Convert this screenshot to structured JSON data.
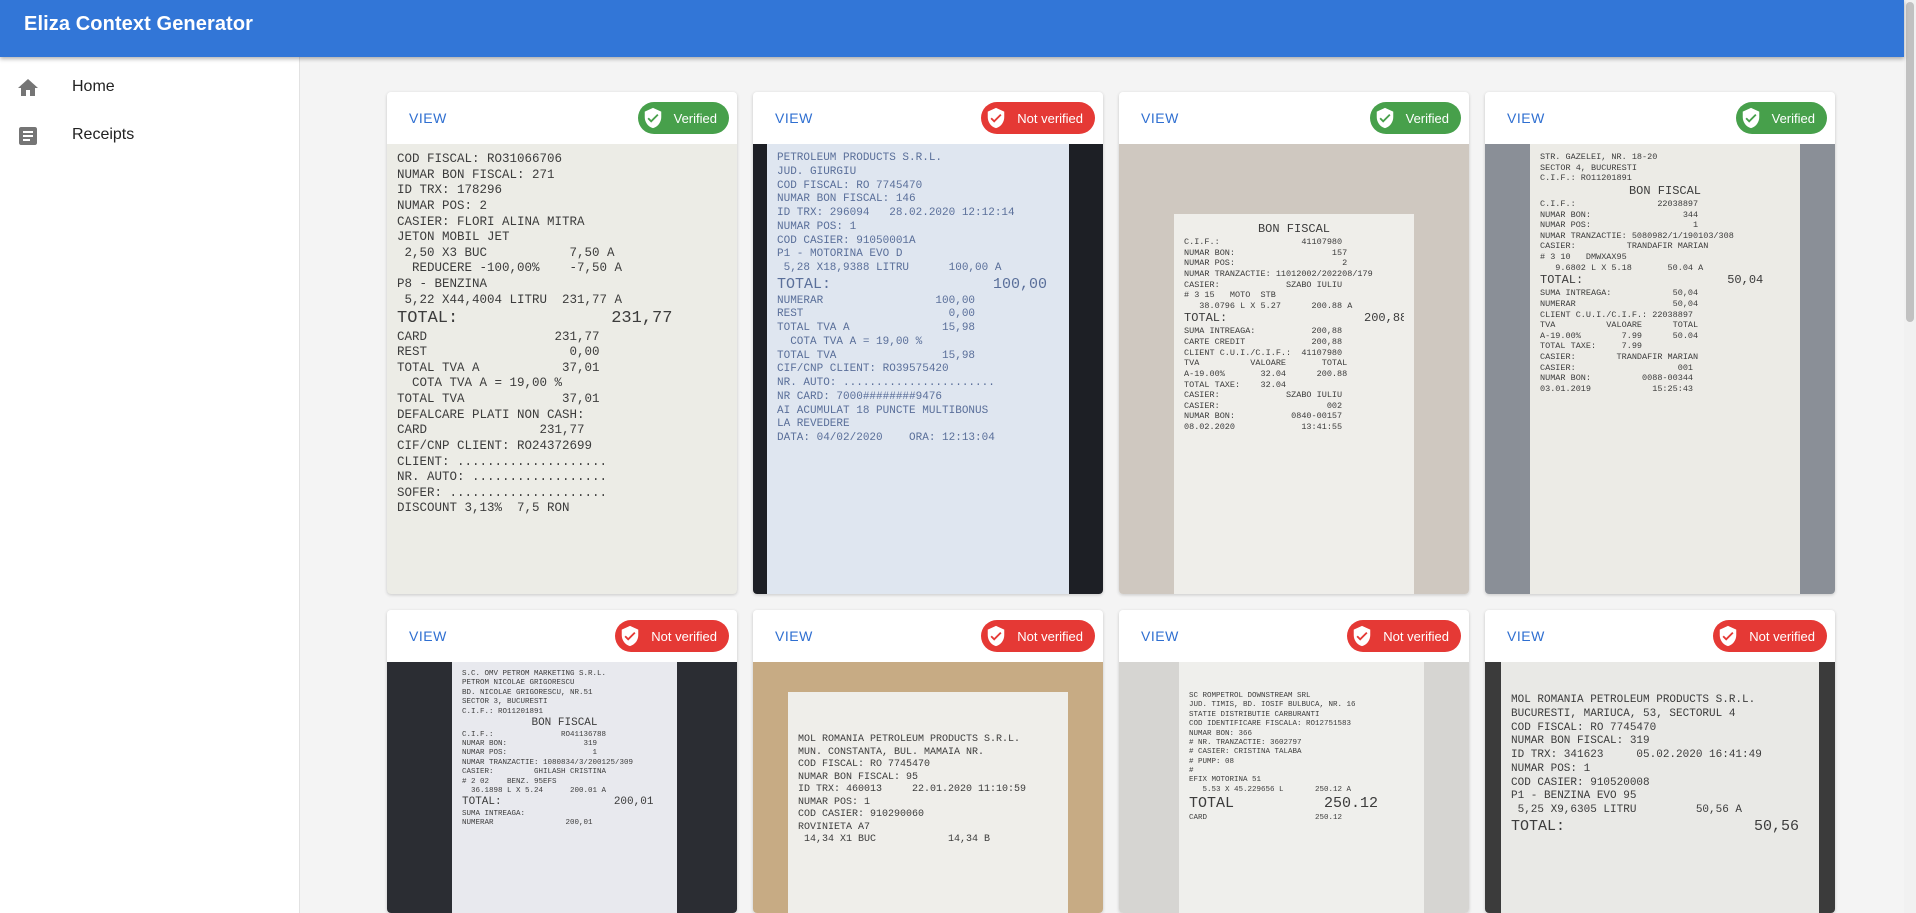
{
  "app": {
    "title": "Eliza Context Generator"
  },
  "nav": [
    {
      "label": "Home",
      "icon": "home-icon"
    },
    {
      "label": "Receipts",
      "icon": "receipt-list-icon"
    }
  ],
  "colors": {
    "appbar": "#3276d7",
    "verified": "#47a04b",
    "not_verified": "#e53935",
    "link": "#2f6fd1"
  },
  "cards": [
    {
      "view_label": "VIEW",
      "status": "Verified",
      "verified": true,
      "receipt_lines": [
        "COD FISCAL: RO31066706",
        "NUMAR BON FISCAL: 271",
        "ID TRX: 178296",
        "NUMAR POS: 2",
        "CASIER: FLORI ALINA MITRA",
        "JETON MOBIL JET",
        " 2,50 X3 BUC           7,50 A",
        "  REDUCERE -100,00%    -7,50 A",
        "P8 - BENZINA",
        " 5,22 X44,4004 LITRU  231,77 A",
        "TOTAL:               231,77",
        "CARD                 231,77",
        "REST                   0,00",
        "TOTAL TVA A           37,01",
        "  COTA TVA A = 19,00 %",
        "TOTAL TVA             37,01",
        "DEFALCARE PLATI NON CASH:",
        "CARD               231,77",
        "CIF/CNP CLIENT: RO24372699",
        "CLIENT: ....................",
        "NR. AUTO: ..................",
        "SOFER: .....................",
        "DISCOUNT 3,13%  7,5 RON"
      ]
    },
    {
      "view_label": "VIEW",
      "status": "Not verified",
      "verified": false,
      "receipt_lines": [
        "PETROLEUM PRODUCTS S.R.L.",
        "JUD. GIURGIU",
        "COD FISCAL: RO 7745470",
        "NUMAR BON FISCAL: 146",
        "ID TRX: 296094   28.02.2020 12:12:14",
        "NUMAR POS: 1",
        "COD CASIER: 91050001A",
        "P1 - MOTORINA EVO D",
        " 5,28 X18,9388 LITRU      100,00 A",
        "TOTAL:                  100,00",
        "NUMERAR                 100,00",
        "REST                      0,00",
        "TOTAL TVA A              15,98",
        "  COTA TVA A = 19,00 %",
        "TOTAL TVA                15,98",
        "CIF/CNP CLIENT: RO39575420",
        "NR. AUTO: .......................",
        "NR CARD: 7000########9476",
        "AI ACUMULAT 18 PUNCTE MULTIBONUS",
        "LA REVEDERE",
        "DATA: 04/02/2020    ORA: 12:13:04"
      ]
    },
    {
      "view_label": "VIEW",
      "status": "Verified",
      "verified": true,
      "receipt_lines": [
        "BON FISCAL",
        "C.I.F.:                41107980",
        "NUMAR BON:                   157",
        "NUMAR POS:                     2",
        "NUMAR TRANZACTIE: 11012002/202208/179",
        "CASIER:             SZABO IULIU",
        "",
        "# 3 15   MOTO  STB",
        "   38.0796 L X 5.27      200.88 A",
        "TOTAL:                   200,88",
        "SUMA INTREAGA:           200,88",
        "CARTE CREDIT             200,88",
        "CLIENT C.U.I./C.I.F.:  41107980",
        "TVA          VALOARE       TOTAL",
        "A-19.00%       32.04      200.88",
        "TOTAL TAXE:    32.04",
        "CASIER:             SZABO IULIU",
        "CASIER:                     002",
        "NUMAR BON:           0840-00157",
        "08.02.2020             13:41:55"
      ]
    },
    {
      "view_label": "VIEW",
      "status": "Verified",
      "verified": true,
      "receipt_lines": [
        "STR. GAZELEI, NR. 18-20",
        "SECTOR 4, BUCURESTI",
        "C.I.F.: RO11201891",
        "BON FISCAL",
        "C.I.F.:                22038897",
        "NUMAR BON:                  344",
        "NUMAR POS:                    1",
        "NUMAR TRANZACTIE: 5080982/1/190103/308",
        "CASIER:          TRANDAFIR MARIAN",
        "",
        "# 3 10   DMWXAX95",
        "   9.6802 L X 5.18       50.04 A",
        "TOTAL:                    50,04",
        "SUMA INTREAGA:            50,04",
        "NUMERAR                   50,04",
        "CLIENT C.U.I./C.I.F.: 22038897",
        "TVA          VALOARE      TOTAL",
        "A-19.00%        7.99      50.04",
        "TOTAL TAXE:     7.99",
        "CASIER:        TRANDAFIR MARIAN",
        "CASIER:                    001",
        "NUMAR BON:          0088-00344",
        "03.01.2019            15:25:43"
      ]
    },
    {
      "view_label": "VIEW",
      "status": "Not verified",
      "verified": false,
      "receipt_lines": [
        "S.C. OMV PETROM MARKETING S.R.L.",
        "PETROM NICOLAE GRIGORESCU",
        "BD. NICOLAE GRIGORESCU, NR.51",
        "SECTOR 3, BUCURESTI",
        "C.I.F.: RO11201891",
        "BON FISCAL",
        "C.I.F.:               RO41136788",
        "NUMAR BON:                 319",
        "NUMAR POS:                   1",
        "NUMAR TRANZACTIE: 1080834/3/200125/309",
        "CASIER:         GHILASH CRISTINA",
        "# 2 02    BENZ. 95EFS",
        "  36.1898 L X 5.24      200.01 A",
        "TOTAL:                 200,01",
        "SUMA INTREAGA:",
        "NUMERAR                200,01"
      ]
    },
    {
      "view_label": "VIEW",
      "status": "Not verified",
      "verified": false,
      "receipt_lines": [
        "MOL ROMANIA PETROLEUM PRODUCTS S.R.L.",
        "MUN. CONSTANTA, BUL. MAMAIA NR.",
        "COD FISCAL: RO 7745470",
        "",
        "NUMAR BON FISCAL: 95",
        "ID TRX: 460013     22.01.2020 11:10:59",
        "NUMAR POS: 1",
        "COD CASIER: 910290060",
        "ROVINIETA A7",
        " 14,34 X1 BUC            14,34 B"
      ]
    },
    {
      "view_label": "VIEW",
      "status": "Not verified",
      "verified": false,
      "receipt_lines": [
        "SC ROMPETROL DOWNSTREAM SRL",
        "JUD. TIMIS, BD. IOSIF BULBUCA, NR. 16",
        "STATIE DISTRIBUTIE CARBURANTI",
        "COD IDENTIFICARE FISCALA: RO12751583",
        "",
        "NUMAR BON: 366",
        "",
        "# NR. TRANZACTIE: 3602797",
        "# CASIER: CRISTINA TALABA",
        "# PUMP: 08",
        "#",
        "EFIX MOTORINA 51",
        "   5.53 X 45.229656 L       250.12 A",
        "",
        "TOTAL          250.12",
        "CARD                        250.12"
      ]
    },
    {
      "view_label": "VIEW",
      "status": "Not verified",
      "verified": false,
      "receipt_lines": [
        "MOL ROMANIA PETROLEUM PRODUCTS S.R.L.",
        "BUCURESTI, MARIUCA, 53, SECTORUL 4",
        "COD FISCAL: RO 7745470",
        "",
        "NUMAR BON FISCAL: 319",
        "ID TRX: 341623     05.02.2020 16:41:49",
        "NUMAR POS: 1",
        "COD CASIER: 910520008",
        "P1 - BENZINA EVO 95",
        " 5,25 X9,6305 LITRU         50,56 A",
        "",
        "TOTAL:                     50,56"
      ]
    }
  ]
}
